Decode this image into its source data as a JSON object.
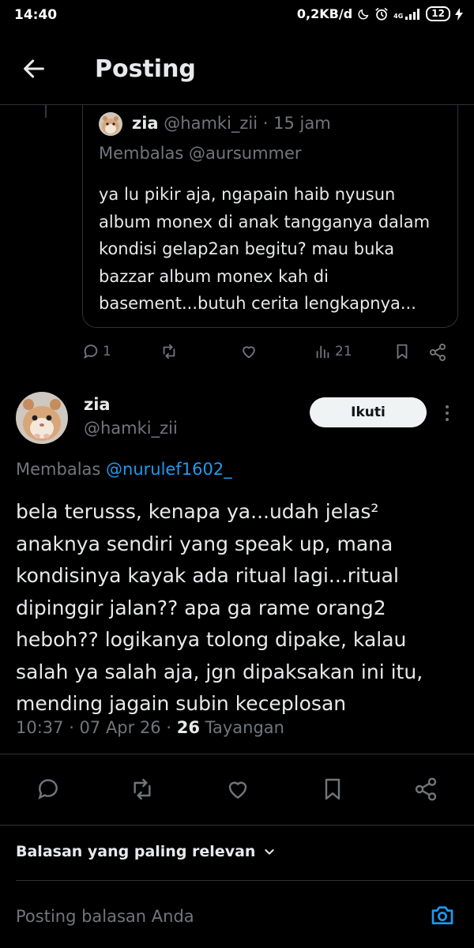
{
  "status_bar": {
    "time": "14:40",
    "network_speed": "0,2KB/d",
    "signal_label": "4G",
    "battery": "12"
  },
  "header": {
    "title": "Posting"
  },
  "quoted_tweet": {
    "name": "zia",
    "handle": "@hamki_zii",
    "age": "· 15 jam",
    "replying_to": "Membalas @aursummer",
    "text": "ya lu pikir aja, ngapain haib nyusun album monex di anak tangganya dalam kondisi gelap2an begitu? mau buka bazzar album monex kah di basement...butuh cerita lengkapnya...",
    "reply_count": "1",
    "view_count": "21"
  },
  "main_tweet": {
    "name": "zia",
    "handle": "@hamki_zii",
    "follow_label": "Ikuti",
    "replying_prefix": "Membalas",
    "replying_user": "@nurulef1602_",
    "text": "bela terusss, kenapa ya...udah jelas² anaknya sendiri yang speak up, mana kondisinya kayak ada ritual lagi...ritual dipinggir jalan?? apa ga rame orang2 heboh?? logikanya tolong dipake, kalau salah ya salah aja, jgn dipaksakan ini itu, mending jagain subin keceplosan",
    "timestamp": "10:37 · 07 Apr 26 ·",
    "views": "26",
    "views_label": "Tayangan"
  },
  "replies_sort": {
    "label": "Balasan yang paling relevan"
  },
  "reply_box": {
    "placeholder": "Posting balasan Anda"
  },
  "colors": {
    "background": "#000000",
    "text": "#e7e9ea",
    "muted": "#71767b",
    "link": "#1d9bf0",
    "border": "#2f3336"
  }
}
